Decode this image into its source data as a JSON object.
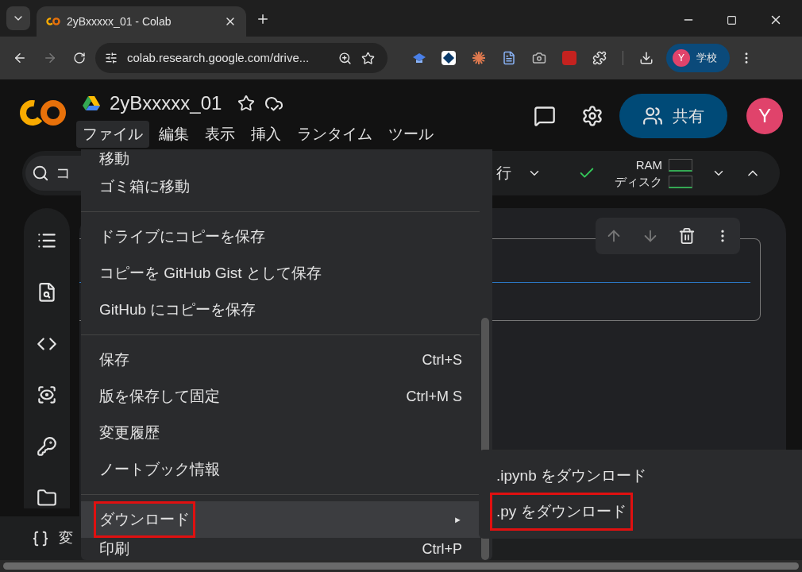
{
  "browser": {
    "tabs": [
      {
        "title": "2yBxxxxx_01 - Colab",
        "selected": true
      }
    ],
    "address": "colab.research.google.com/drive...",
    "profile": {
      "avatar": "Y",
      "label": "学校"
    }
  },
  "colab": {
    "title": "2yBxxxxx_01",
    "menus": [
      {
        "label": "ファイル",
        "selected": true
      },
      {
        "label": "編集",
        "selected": false
      },
      {
        "label": "表示",
        "selected": false
      },
      {
        "label": "挿入",
        "selected": false
      },
      {
        "label": "ランタイム",
        "selected": false
      },
      {
        "label": "ツール",
        "selected": false
      }
    ],
    "share": "共有",
    "avatar": "Y"
  },
  "toolbar": {
    "search": "コ",
    "run": "行",
    "connected": true,
    "ram": "RAM",
    "disk": "ディスク"
  },
  "file_menu": {
    "items": [
      {
        "kind": "item",
        "label": "移動",
        "highlighted": false,
        "annotated": false
      },
      {
        "kind": "item",
        "label": "ゴミ箱に移動",
        "highlighted": false,
        "annotated": false
      },
      {
        "kind": "divider"
      },
      {
        "kind": "item",
        "label": "ドライブにコピーを保存",
        "highlighted": false,
        "annotated": false
      },
      {
        "kind": "item",
        "label": "コピーを GitHub Gist として保存",
        "highlighted": false,
        "annotated": false
      },
      {
        "kind": "item",
        "label": "GitHub にコピーを保存",
        "highlighted": false,
        "annotated": false
      },
      {
        "kind": "divider"
      },
      {
        "kind": "item",
        "label": "保存",
        "shortcut": "Ctrl+S",
        "highlighted": false,
        "annotated": false
      },
      {
        "kind": "item",
        "label": "版を保存して固定",
        "shortcut": "Ctrl+M S",
        "highlighted": false,
        "annotated": false
      },
      {
        "kind": "item",
        "label": "変更履歴",
        "highlighted": false,
        "annotated": false
      },
      {
        "kind": "item",
        "label": "ノートブック情報",
        "highlighted": false,
        "annotated": false
      },
      {
        "kind": "divider"
      },
      {
        "kind": "item",
        "label": "ダウンロード",
        "submenu": "►",
        "highlighted": true,
        "annotated": true
      },
      {
        "kind": "item",
        "label": "印刷",
        "shortcut": "Ctrl+P",
        "highlighted": false,
        "annotated": false
      }
    ]
  },
  "download_menu": {
    "items": [
      {
        "label": ".ipynb をダウンロード",
        "annotated": false
      },
      {
        "label": ".py をダウンロード",
        "annotated": true
      }
    ]
  },
  "status_bar": {
    "variables": "変"
  }
}
